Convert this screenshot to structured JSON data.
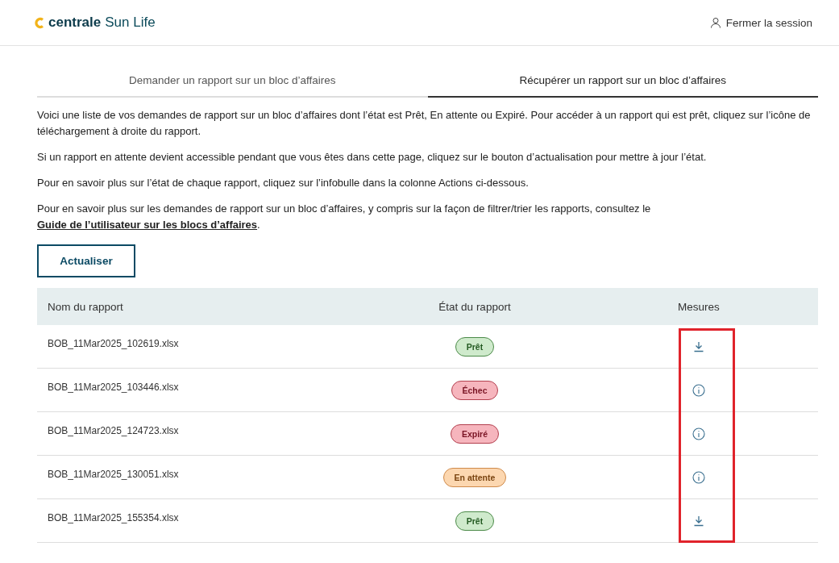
{
  "header": {
    "logo_text_bold": "centrale",
    "logo_text": "Sun Life",
    "logout_label": "Fermer la session"
  },
  "tabs": [
    {
      "label": "Demander un rapport sur un bloc d’affaires",
      "selected": false
    },
    {
      "label": "Récupérer un rapport sur un bloc d’affaires",
      "selected": true
    }
  ],
  "paragraphs": [
    "Voici une liste de vos demandes de rapport sur un bloc d’affaires dont l’état est Prêt, En attente ou Expiré. Pour accéder à un rapport qui est prêt, cliquez sur l’icône de téléchargement à droite du rapport.",
    "Si un rapport en attente devient accessible pendant que vous êtes dans cette page, cliquez sur le bouton d’actualisation pour mettre à jour l’état.",
    "Pour en savoir plus sur l’état de chaque rapport, cliquez sur l’infobulle dans la colonne Actions ci-dessous."
  ],
  "guide_paragraph": {
    "text": "Pour en savoir plus sur les demandes de rapport sur un bloc d’affaires, y compris sur la façon de filtrer/trier les rapports, consultez le ",
    "link": "Guide de l’utilisateur sur les blocs d’affaires",
    "end": "."
  },
  "refresh_button": "Actualiser",
  "table": {
    "columns": [
      "Nom du rapport",
      "État du rapport",
      "Mesures"
    ],
    "actions_highlighted": true,
    "rows": [
      {
        "name": "BOB_11Mar2025_102619.xlsx",
        "status": {
          "label": "Prêt",
          "kind": "ready"
        },
        "action": {
          "kind": "download"
        }
      },
      {
        "name": "BOB_11Mar2025_103446.xlsx",
        "status": {
          "label": "Échec",
          "kind": "failed"
        },
        "action": {
          "kind": "info"
        }
      },
      {
        "name": "BOB_11Mar2025_124723.xlsx",
        "status": {
          "label": "Expiré",
          "kind": "expired"
        },
        "action": {
          "kind": "info"
        }
      },
      {
        "name": "BOB_11Mar2025_130051.xlsx",
        "status": {
          "label": "En attente",
          "kind": "pending"
        },
        "action": {
          "kind": "info"
        }
      },
      {
        "name": "BOB_11Mar2025_155354.xlsx",
        "status": {
          "label": "Prêt",
          "kind": "ready"
        },
        "action": {
          "kind": "download"
        }
      }
    ]
  }
}
